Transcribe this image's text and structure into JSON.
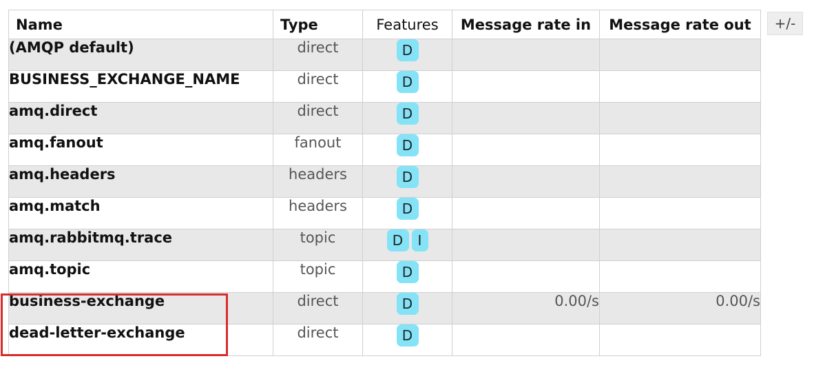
{
  "columns": {
    "name": "Name",
    "type": "Type",
    "features": "Features",
    "rate_in": "Message rate in",
    "rate_out": "Message rate out"
  },
  "toggle_label": "+/-",
  "exchanges": [
    {
      "name": "(AMQP default)",
      "type": "direct",
      "features": [
        "D"
      ],
      "rate_in": "",
      "rate_out": ""
    },
    {
      "name": "BUSINESS_EXCHANGE_NAME",
      "type": "direct",
      "features": [
        "D"
      ],
      "rate_in": "",
      "rate_out": ""
    },
    {
      "name": "amq.direct",
      "type": "direct",
      "features": [
        "D"
      ],
      "rate_in": "",
      "rate_out": ""
    },
    {
      "name": "amq.fanout",
      "type": "fanout",
      "features": [
        "D"
      ],
      "rate_in": "",
      "rate_out": ""
    },
    {
      "name": "amq.headers",
      "type": "headers",
      "features": [
        "D"
      ],
      "rate_in": "",
      "rate_out": ""
    },
    {
      "name": "amq.match",
      "type": "headers",
      "features": [
        "D"
      ],
      "rate_in": "",
      "rate_out": ""
    },
    {
      "name": "amq.rabbitmq.trace",
      "type": "topic",
      "features": [
        "D",
        "I"
      ],
      "rate_in": "",
      "rate_out": ""
    },
    {
      "name": "amq.topic",
      "type": "topic",
      "features": [
        "D"
      ],
      "rate_in": "",
      "rate_out": ""
    },
    {
      "name": "business-exchange",
      "type": "direct",
      "features": [
        "D"
      ],
      "rate_in": "0.00/s",
      "rate_out": "0.00/s"
    },
    {
      "name": "dead-letter-exchange",
      "type": "direct",
      "features": [
        "D"
      ],
      "rate_in": "",
      "rate_out": ""
    }
  ],
  "colors": {
    "badge": "#84e3f7",
    "row_alt": "#e8e8e8",
    "highlight": "#d92b2b"
  }
}
